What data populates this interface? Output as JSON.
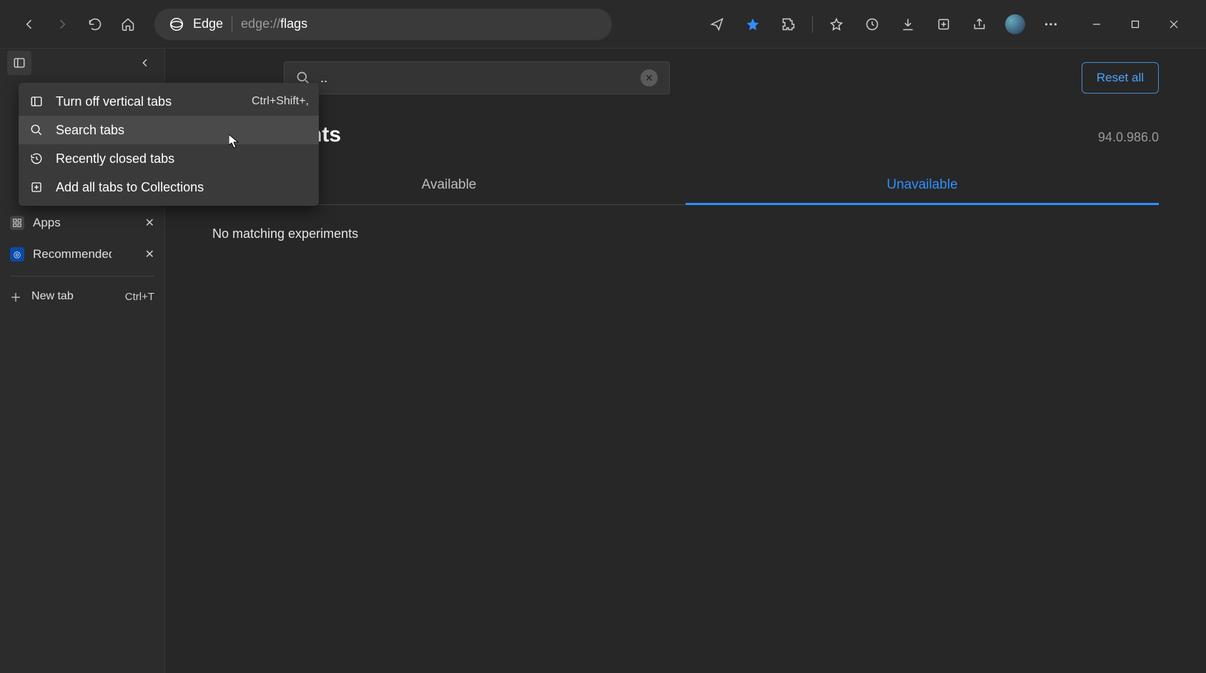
{
  "address_bar": {
    "label": "Edge",
    "url_prefix": "edge://",
    "url_path": "flags"
  },
  "sidebar": {
    "tabs": [
      {
        "label": "Apps",
        "kind": "apps"
      },
      {
        "label": "Recommended D",
        "kind": "rec"
      }
    ],
    "new_tab_label": "New tab",
    "new_tab_shortcut": "Ctrl+T"
  },
  "context_menu": {
    "items": [
      {
        "label": "Turn off vertical tabs",
        "shortcut": "Ctrl+Shift+,",
        "icon": "panel"
      },
      {
        "label": "Search tabs",
        "shortcut": "",
        "icon": "search",
        "hover": true
      },
      {
        "label": "Recently closed tabs",
        "shortcut": "",
        "icon": "history"
      },
      {
        "label": "Add all tabs to Collections",
        "shortcut": "",
        "icon": "collections"
      }
    ]
  },
  "flags": {
    "search_value": "..",
    "reset_label": "Reset all",
    "heading": "Experiments",
    "version": "94.0.986.0",
    "tab_available": "Available",
    "tab_unavailable": "Unavailable",
    "empty_message": "No matching experiments"
  }
}
